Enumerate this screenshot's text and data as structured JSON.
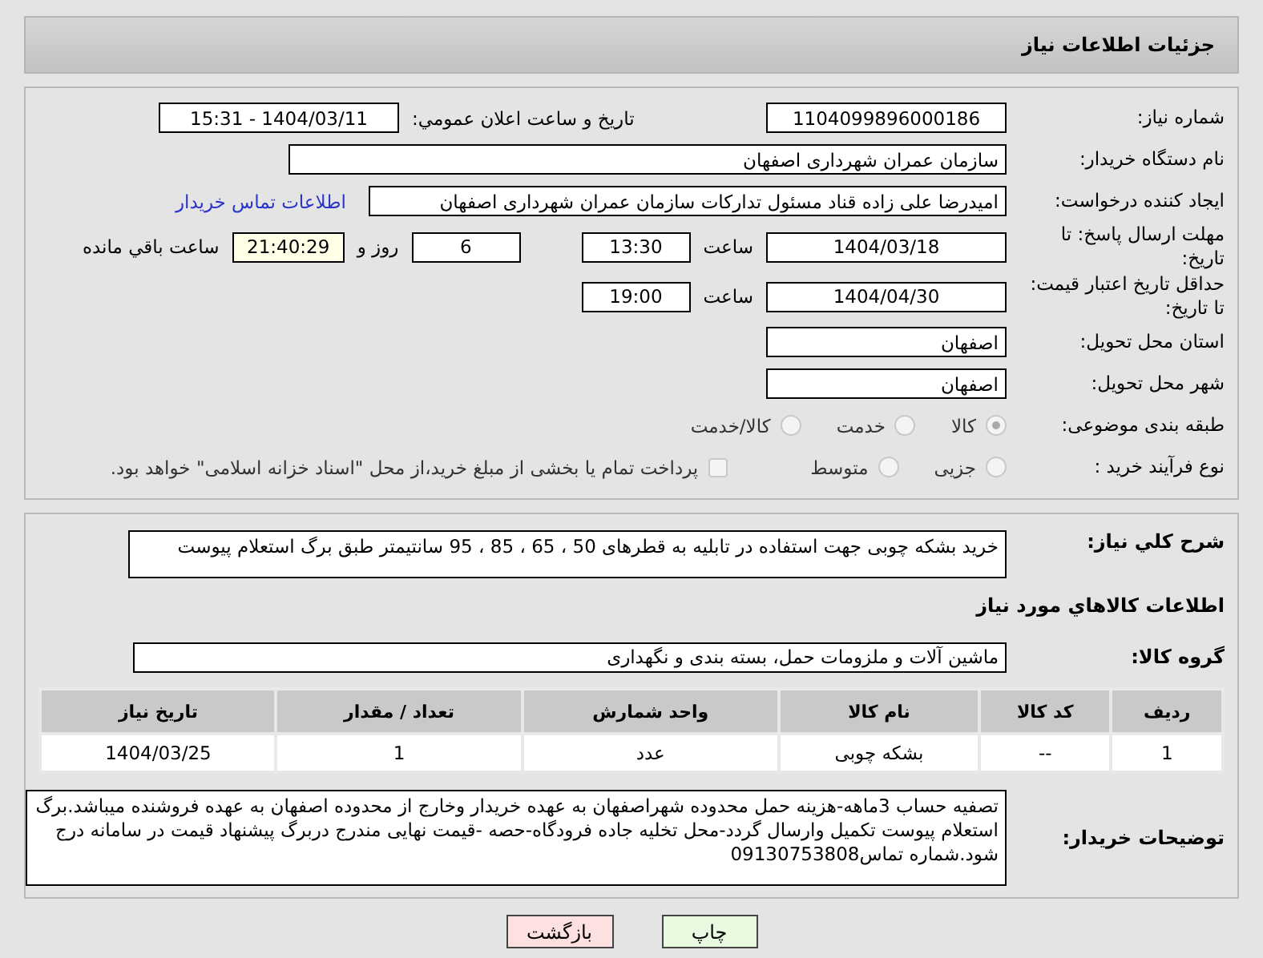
{
  "header": {
    "title": "جزئیات اطلاعات نیاز"
  },
  "need_number": {
    "label": "شماره نیاز:",
    "value": "1104099896000186"
  },
  "announce": {
    "label": "تاریخ و ساعت اعلان عمومي:",
    "value": "1404/03/11 - 15:31"
  },
  "buyer_org": {
    "label": "نام دستگاه خریدار:",
    "value": "سازمان عمران شهرداری اصفهان"
  },
  "creator": {
    "label": "ایجاد کننده درخواست:",
    "value": "امیدرضا علی زاده قناد مسئول تدارکات سازمان عمران شهرداری اصفهان",
    "link": "اطلاعات تماس خریدار"
  },
  "deadline": {
    "label": "مهلت ارسال پاسخ: تا تاریخ:",
    "date": "1404/03/18",
    "time_label": "ساعت",
    "time": "13:30",
    "days": "6",
    "days_label": "روز و",
    "remaining": "21:40:29",
    "remaining_label": "ساعت باقي مانده"
  },
  "validity": {
    "label": "حداقل تاریخ اعتبار قیمت: تا تاریخ:",
    "date": "1404/04/30",
    "time_label": "ساعت",
    "time": "19:00"
  },
  "province": {
    "label": "استان محل تحویل:",
    "value": "اصفهان"
  },
  "city": {
    "label": "شهر محل تحویل:",
    "value": "اصفهان"
  },
  "category": {
    "label": "طبقه بندی موضوعی:",
    "options": [
      {
        "label": "کالا",
        "selected": true
      },
      {
        "label": "خدمت",
        "selected": false
      },
      {
        "label": "کالا/خدمت",
        "selected": false
      }
    ]
  },
  "process": {
    "label": "نوع فرآیند خرید :",
    "options": [
      {
        "label": "جزیی",
        "selected": false
      },
      {
        "label": "متوسط",
        "selected": false
      }
    ],
    "payment": {
      "label": "پرداخت تمام یا بخشی از مبلغ خرید،از محل \"اسناد خزانه اسلامی\" خواهد بود.",
      "checked": false
    }
  },
  "description": {
    "label": "شرح کلي نیاز:",
    "value": "خرید بشکه چوبی جهت استفاده در تابلیه به قطرهای 50 ، 65 ، 85 ، 95 سانتیمتر طبق برگ استعلام پیوست"
  },
  "goods_heading": "اطلاعات کالاهاي مورد نیاز",
  "goods_group": {
    "label": "گروه کالا:",
    "value": "ماشین آلات و ملزومات حمل، بسته بندی و نگهداری"
  },
  "table": {
    "columns": [
      "ردیف",
      "کد کالا",
      "نام کالا",
      "واحد شمارش",
      "تعداد / مقدار",
      "تاریخ نیاز"
    ],
    "rows": [
      [
        "1",
        "--",
        "بشکه چوبی",
        "عدد",
        "1",
        "1404/03/25"
      ]
    ]
  },
  "buyer_notes": {
    "label": "توضیحات خریدار:",
    "value": "تصفیه حساب 3ماهه-هزینه حمل محدوده شهراصفهان به عهده خریدار وخارج از محدوده اصفهان به عهده فروشنده میباشد.برگ استعلام پیوست تکمیل وارسال گردد-محل تخلیه جاده فرودگاه-حصه -قیمت نهایی مندرج دربرگ پیشنهاد قیمت در سامانه درج شود.شماره تماس09130753808"
  },
  "buttons": [
    {
      "label": "چاپ",
      "kind": "print"
    },
    {
      "label": "بازگشت",
      "kind": "back"
    }
  ]
}
